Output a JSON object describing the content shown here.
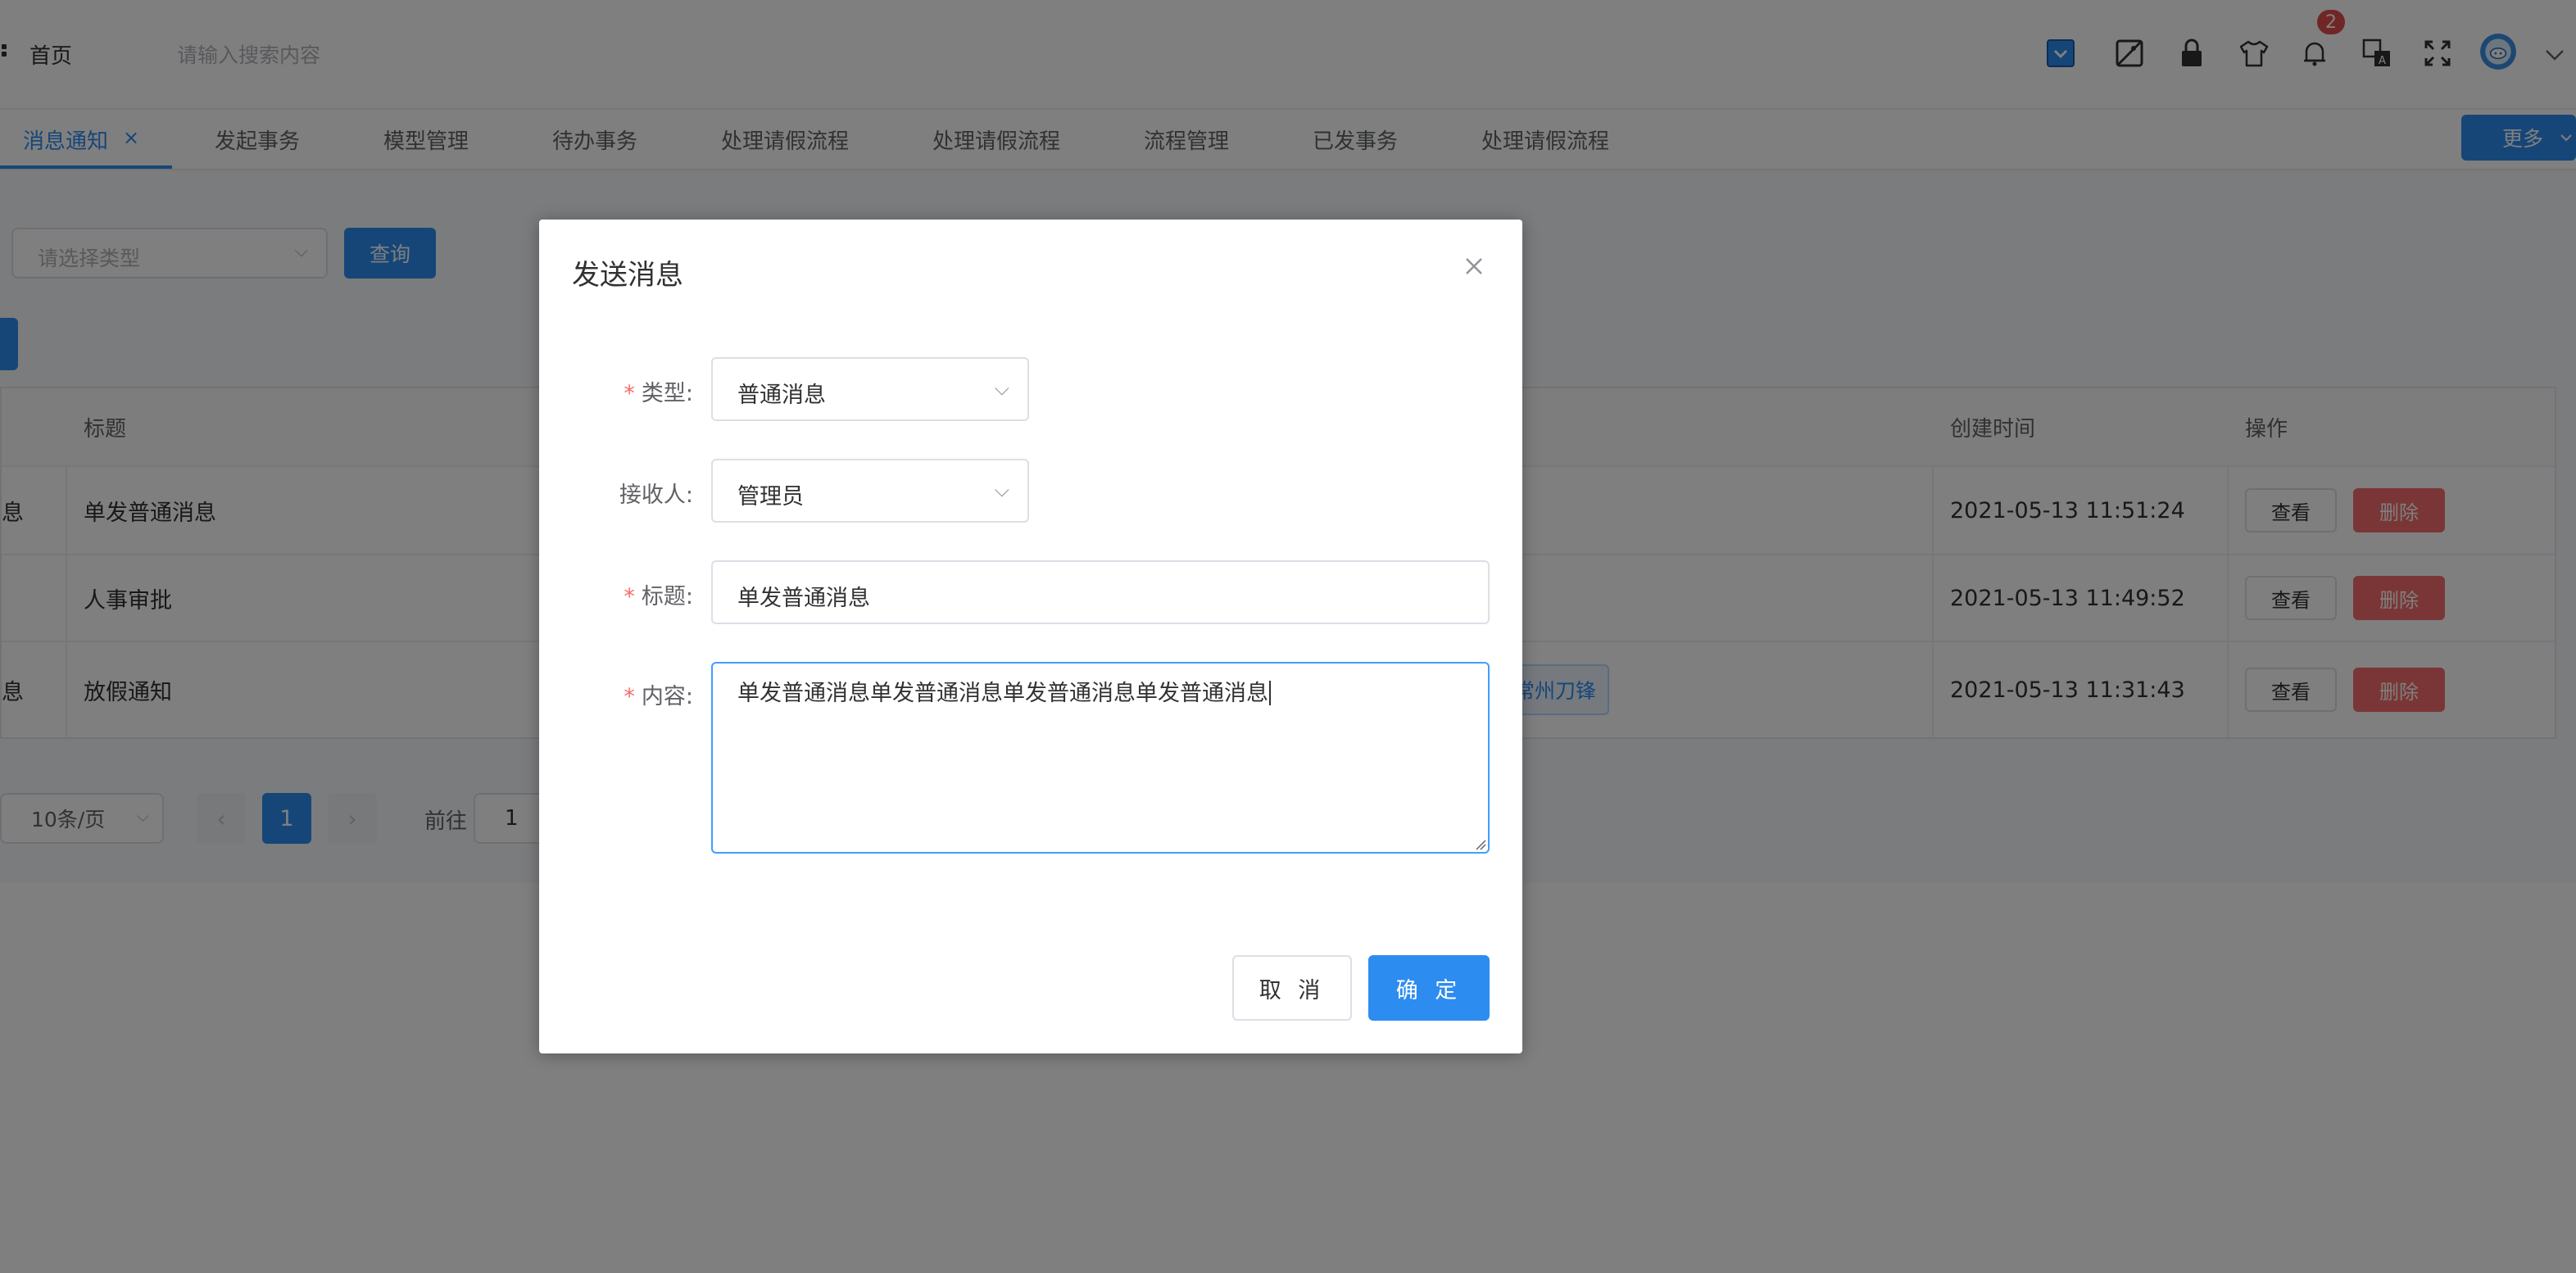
{
  "header": {
    "breadcrumb": "首页",
    "search_placeholder": "请输入搜索内容",
    "notification_count": "2",
    "icons": [
      "app-switch-icon",
      "image-off-icon",
      "lock-icon",
      "theme-shirt-icon",
      "bell-icon",
      "translate-icon",
      "fullscreen-icon",
      "avatar",
      "chevron-down-icon"
    ]
  },
  "tabs": {
    "items": [
      {
        "label": "消息通知",
        "active": true
      },
      {
        "label": "发起事务"
      },
      {
        "label": "模型管理"
      },
      {
        "label": "待办事务"
      },
      {
        "label": "处理请假流程"
      },
      {
        "label": "处理请假流程"
      },
      {
        "label": "流程管理"
      },
      {
        "label": "已发事务"
      },
      {
        "label": "处理请假流程"
      }
    ],
    "more_label": "更多"
  },
  "filter": {
    "type_placeholder": "请选择类型",
    "query_label": "查询"
  },
  "table": {
    "headers": {
      "title": "标题",
      "created": "创建时间",
      "actions": "操作"
    },
    "rows": [
      {
        "type_fragment": "息",
        "title": "单发普通消息",
        "created": "2021-05-13 11:51:24"
      },
      {
        "type_fragment": "",
        "title": "人事审批",
        "created": "2021-05-13 11:49:52"
      },
      {
        "type_fragment": "息",
        "title": "放假通知",
        "created": "2021-05-13 11:31:43",
        "receiver_tag": "常州刀锋"
      }
    ],
    "view_label": "查看",
    "delete_label": "删除"
  },
  "pagination": {
    "page_size": "10条/页",
    "current_page": "1",
    "goto_label": "前往",
    "goto_value": "1"
  },
  "dialog": {
    "title": "发送消息",
    "fields": {
      "type": {
        "label": "类型:",
        "value": "普通消息",
        "required": true
      },
      "receiver": {
        "label": "接收人:",
        "value": "管理员",
        "required": false
      },
      "title": {
        "label": "标题:",
        "value": "单发普通消息",
        "required": true
      },
      "content": {
        "label": "内容:",
        "value": "单发普通消息单发普通消息单发普通消息单发普通消息",
        "required": true
      }
    },
    "cancel_label": "取 消",
    "confirm_label": "确 定"
  },
  "colors": {
    "primary": "#2d8cf0",
    "danger": "#f56c6c",
    "overlay": "rgba(0,0,0,0.5)"
  }
}
